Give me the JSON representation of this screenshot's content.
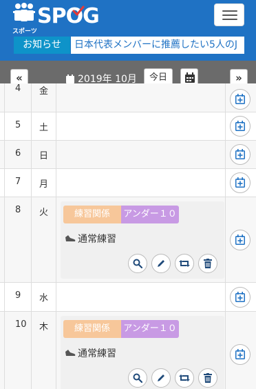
{
  "header": {
    "logo_text": "SPOG",
    "logo_sub": "スポーツ",
    "menu_icon": "hamburger-icon",
    "brand_color": "#1f72c4"
  },
  "news": {
    "label": "お知らせ",
    "ticker": "日本代表メンバーに推薦したい5人のJ"
  },
  "nav": {
    "prev": "«",
    "next": "»",
    "month": "2019年 10月",
    "today": "今日"
  },
  "rows": [
    {
      "day": "4",
      "wd": "金"
    },
    {
      "day": "5",
      "wd": "土"
    },
    {
      "day": "6",
      "wd": "日"
    },
    {
      "day": "7",
      "wd": "月"
    },
    {
      "day": "8",
      "wd": "火",
      "event": {
        "tag1": "練習関係",
        "tag2": "アンダー１０",
        "title": "通常練習"
      }
    },
    {
      "day": "9",
      "wd": "水"
    },
    {
      "day": "10",
      "wd": "木",
      "event": {
        "tag1": "練習関係",
        "tag2": "アンダー１０",
        "title": "通常練習"
      }
    }
  ],
  "colors": {
    "accent": "#1f72c4",
    "news_label": "#0e93c9",
    "tag_practice": "#f7c79a",
    "tag_under10": "#c89ae4",
    "nav_bg": "#6b6b6b"
  }
}
